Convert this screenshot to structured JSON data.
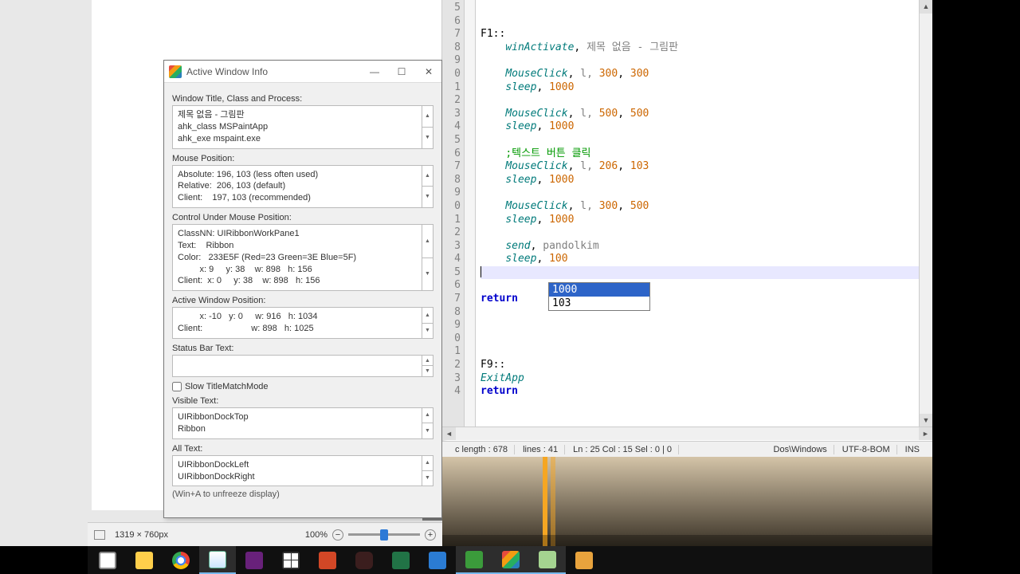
{
  "paint": {
    "dims": "1319 × 760px",
    "zoom": "100%"
  },
  "awi": {
    "title": "Active Window Info",
    "labels": {
      "wtitle": "Window Title, Class and Process:",
      "mouse": "Mouse Position:",
      "control": "Control Under Mouse Position:",
      "active": "Active Window Position:",
      "status": "Status Bar Text:",
      "slow": "Slow TitleMatchMode",
      "visible": "Visible Text:",
      "all": "All Text:",
      "hint": "(Win+A to unfreeze display)"
    },
    "wtitle_box": "제목 없음 - 그림판\nahk_class MSPaintApp\nahk_exe mspaint.exe",
    "mouse_box": "Absolute: 196, 103 (less often used)\nRelative:  206, 103 (default)\nClient:    197, 103 (recommended)",
    "control_box": "ClassNN: UIRibbonWorkPane1\nText:    Ribbon\nColor:   233E5F (Red=23 Green=3E Blue=5F)\n         x: 9     y: 38    w: 898   h: 156\nClient:  x: 0     y: 38    w: 898   h: 156",
    "active_box": "         x: -10   y: 0     w: 916   h: 1034\nClient:                    w: 898   h: 1025",
    "visible_box": "UIRibbonDockTop\nRibbon",
    "all_box": "UIRibbonDockLeft\nUIRibbonDockRight"
  },
  "editor": {
    "line_start": 5,
    "lines": [
      "",
      "",
      "F1::",
      "    winActivate, 제목 없음 - 그림판",
      "",
      "    MouseClick, l, 300, 300",
      "    sleep, 1000",
      "",
      "    MouseClick, l, 500, 500",
      "    sleep, 1000",
      "",
      "    ;텍스트 버튼 클릭",
      "    MouseClick, l, 206, 103",
      "    sleep, 1000",
      "",
      "    MouseClick, l, 300, 500",
      "    sleep, 1000",
      "",
      "    send, pandolkim",
      "    sleep, 100",
      "",
      "",
      "return",
      "",
      "",
      "",
      "",
      "F9::",
      "ExitApp",
      "return"
    ],
    "autocomplete": [
      "1000",
      "103"
    ],
    "status": {
      "length": "c length : 678",
      "lines": "lines : 41",
      "pos": "Ln : 25    Col : 15    Sel : 0 | 0",
      "eol": "Dos\\Windows",
      "enc": "UTF-8-BOM",
      "mode": "INS"
    }
  },
  "taskbar": {
    "items": [
      "task-view",
      "explorer",
      "chrome",
      "paint",
      "vs",
      "calculator",
      "powerpoint",
      "kakao",
      "excel",
      "edge",
      "ahk",
      "ahk2",
      "notepadpp",
      "tool"
    ]
  }
}
